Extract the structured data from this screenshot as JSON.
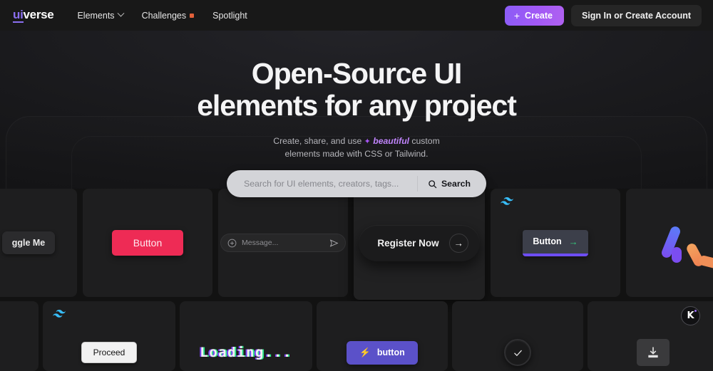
{
  "header": {
    "logo_ui": "ui",
    "logo_verse": "verse",
    "nav": [
      {
        "label": "Elements",
        "icon": "chevron-down-icon",
        "has_dot": false
      },
      {
        "label": "Challenges",
        "icon": "",
        "has_dot": true
      },
      {
        "label": "Spotlight",
        "icon": "",
        "has_dot": false
      }
    ],
    "create_label": "Create",
    "create_icon": "plus-icon",
    "signin_label": "Sign In or Create Account",
    "accent_purple": "#8b5cf6",
    "challenge_dot_color": "#e2603a"
  },
  "hero": {
    "title_line1": "Open-Source UI",
    "title_line2": "elements for any project",
    "sub_pre": "Create, share, and use ",
    "sub_sparkle": "✦",
    "sub_highlight": "beautiful",
    "sub_post": " custom",
    "sub_line2": "elements made with CSS or Tailwind.",
    "highlight_color": "#c084fc"
  },
  "search": {
    "placeholder": "Search for UI elements, creators, tags...",
    "value": "",
    "button_label": "Search",
    "button_icon": "search-icon"
  },
  "cards": {
    "row1": [
      {
        "name": "toggle-card",
        "widget": "toggle-pill",
        "label": "ggle Me",
        "badge": ""
      },
      {
        "name": "pink-button-card",
        "widget": "pink-button",
        "label": "Button",
        "badge": ""
      },
      {
        "name": "message-input-card",
        "widget": "message-bar",
        "label": "Message...",
        "badge": "",
        "left_icon": "plus-circle-icon",
        "right_icon": "send-icon"
      },
      {
        "name": "register-card",
        "widget": "register-pill",
        "label": "Register Now",
        "badge": "",
        "right_icon": "arrow-right-icon"
      },
      {
        "name": "tailwind-button-card",
        "widget": "tailwind-button",
        "label": "Button",
        "badge": "tailwind-logo",
        "right_icon": "arrow-right-icon"
      },
      {
        "name": "loader-card",
        "widget": "color-loader",
        "label": "",
        "badge": ""
      }
    ],
    "row2": [
      {
        "name": "partial-card-left",
        "widget": "none",
        "label": "",
        "badge": ""
      },
      {
        "name": "proceed-card",
        "widget": "proceed-button",
        "label": "Proceed",
        "badge": "tailwind-logo"
      },
      {
        "name": "loading-glitch-card",
        "widget": "glitch-text",
        "label": "Loading...",
        "badge": ""
      },
      {
        "name": "lightning-button-card",
        "widget": "lightning-button",
        "label": "button",
        "badge": "",
        "left_icon": "lightning-icon"
      },
      {
        "name": "check-card",
        "widget": "check-circle",
        "label": "",
        "badge": "",
        "icon": "check-icon"
      },
      {
        "name": "download-card",
        "widget": "download-button",
        "label": "",
        "badge": "",
        "icon": "download-icon"
      }
    ]
  },
  "help_widget": {
    "glyph": "K",
    "name": "help-badge"
  }
}
